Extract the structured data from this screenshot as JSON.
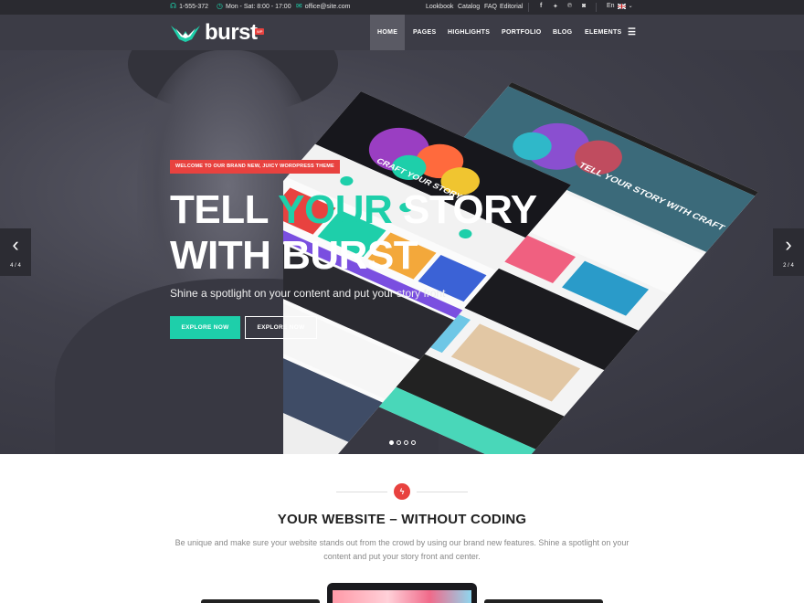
{
  "topbar": {
    "phone": "1-555-372",
    "hours": "Mon - Sat: 8:00 - 17:00",
    "email": "office@site.com",
    "links": [
      "Lookbook",
      "Catalog",
      "FAQ",
      "Editorial"
    ],
    "language": "En"
  },
  "nav": {
    "logo_text": "burst",
    "logo_badge": "WP",
    "items": [
      "HOME",
      "PAGES",
      "HIGHLIGHTS",
      "PORTFOLIO",
      "BLOG",
      "ELEMENTS"
    ],
    "active": "HOME"
  },
  "hero": {
    "badge": "WELCOME TO OUR BRAND NEW, JUICY WORDPRESS THEME",
    "headline_1a": "TELL ",
    "headline_1b": "YOUR",
    "headline_1c": " STORY",
    "headline_2": "WITH BURST",
    "subtitle": "Shine a spotlight on your content and put your story front",
    "btn_primary": "EXPLORE NOW",
    "btn_secondary": "EXPLORE NOW",
    "prev_counter": "4 / 4",
    "next_counter": "2 / 4",
    "mockup_text_1": "CRAFT YOUR STORY",
    "mockup_text_2": "TELL YOUR STORY WITH CRAFT",
    "slides_total": 4,
    "slide_active": 1
  },
  "section": {
    "title": "YOUR WEBSITE – WITHOUT CODING",
    "text": "Be unique and make sure your website stands out from the crowd by using our brand new features. Shine a spotlight on your content and put your story front and center."
  },
  "colors": {
    "accent": "#1ecfaa",
    "red": "#e8423f",
    "dark": "#3c3c46"
  }
}
